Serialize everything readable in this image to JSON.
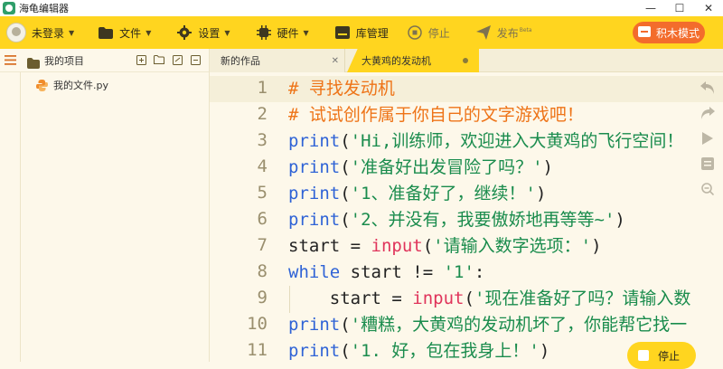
{
  "window": {
    "title": "海龟编辑器",
    "controls": {
      "minimize": "—",
      "maximize": "☐",
      "close": "✕"
    }
  },
  "toolbar": {
    "login_label": "未登录",
    "file_label": "文件",
    "settings_label": "设置",
    "hardware_label": "硬件",
    "library_label": "库管理",
    "stop_label": "停止",
    "publish_label": "发布",
    "publish_badge": "Beta",
    "mode_label": "积木模式"
  },
  "sidebar": {
    "project_label": "我的项目",
    "files": [
      {
        "name": "我的文件.py"
      }
    ]
  },
  "tabs": [
    {
      "label": "新的作品",
      "active": false
    },
    {
      "label": "大黄鸡的发动机",
      "active": true
    }
  ],
  "editor": {
    "line_numbers": [
      "1",
      "2",
      "3",
      "4",
      "5",
      "6",
      "7",
      "8",
      "9",
      "10",
      "11"
    ],
    "lines": [
      {
        "comment": "# 寻找发动机"
      },
      {
        "comment": "# 试试创作属于你自己的文字游戏吧！"
      },
      {
        "fn": "print",
        "open": "(",
        "str": "'Hi,训练师，欢迎进入大黄鸡的飞行空间！"
      },
      {
        "fn": "print",
        "open": "(",
        "str": "'准备好出发冒险了吗？'",
        "close": ")"
      },
      {
        "fn": "print",
        "open": "(",
        "str": "'1、准备好了，继续！'",
        "close": ")"
      },
      {
        "fn": "print",
        "open": "(",
        "str": "'2、并没有，我要傲娇地再等等~'",
        "close": ")"
      },
      {
        "var": "start = ",
        "call": "input",
        "open": "(",
        "str": "'请输入数字选项：'",
        "close": ")"
      },
      {
        "kw": "while",
        "mid": " start != ",
        "str": "'1'",
        "close": ":"
      },
      {
        "indent": "    ",
        "var": "start = ",
        "call": "input",
        "open": "(",
        "str": "'现在准备好了吗？请输入数"
      },
      {
        "fn": "print",
        "open": "(",
        "str": "'糟糕，大黄鸡的发动机坏了，你能帮它找一"
      },
      {
        "fn": "print",
        "open": "(",
        "str": "'1. 好，包在我身上！'",
        "close": ")"
      }
    ]
  },
  "run_control": {
    "stop_label": "停止"
  },
  "colors": {
    "toolbar_bg": "#ffd51f",
    "mode_button": "#f36c2c",
    "comment": "#ee7418",
    "keyword": "#2f63d6",
    "builtin": "#e0345b",
    "string": "#1a8c4d"
  }
}
